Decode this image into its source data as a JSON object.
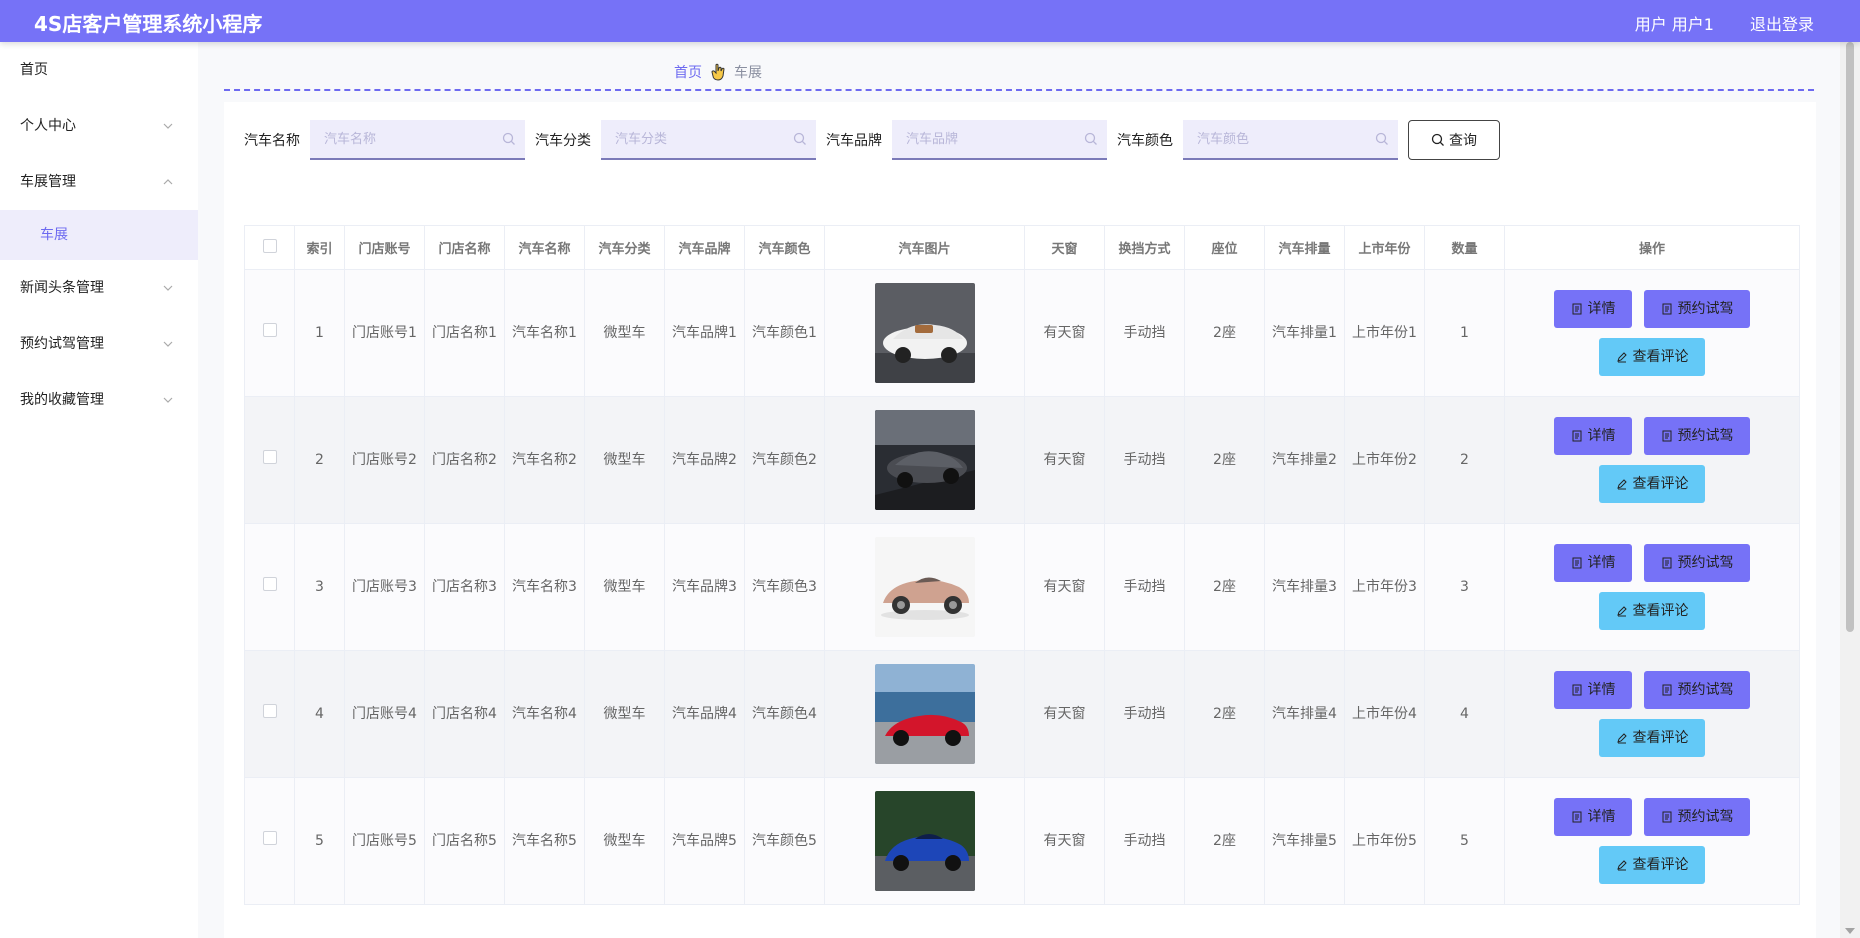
{
  "header": {
    "title": "4S店客户管理系统小程序",
    "user": "用户 用户1",
    "logout": "退出登录"
  },
  "sidebar": {
    "items": [
      {
        "label": "首页",
        "chevron": "none"
      },
      {
        "label": "个人中心",
        "chevron": "down"
      },
      {
        "label": "车展管理",
        "chevron": "up"
      },
      {
        "label": "车展",
        "chevron": "sub"
      },
      {
        "label": "新闻头条管理",
        "chevron": "down"
      },
      {
        "label": "预约试驾管理",
        "chevron": "down"
      },
      {
        "label": "我的收藏管理",
        "chevron": "down"
      }
    ]
  },
  "breadcrumb": {
    "home": "首页",
    "separator_icon": "hand-pointer-icon",
    "current": "车展"
  },
  "search": {
    "fields": [
      {
        "label": "汽车名称",
        "placeholder": "汽车名称"
      },
      {
        "label": "汽车分类",
        "placeholder": "汽车分类"
      },
      {
        "label": "汽车品牌",
        "placeholder": "汽车品牌"
      },
      {
        "label": "汽车颜色",
        "placeholder": "汽车颜色"
      }
    ],
    "button": "查询"
  },
  "table": {
    "headers": [
      "",
      "索引",
      "门店账号",
      "门店名称",
      "汽车名称",
      "汽车分类",
      "汽车品牌",
      "汽车颜色",
      "汽车图片",
      "天窗",
      "换挡方式",
      "座位",
      "汽车排量",
      "上市年份",
      "数量",
      "操作"
    ],
    "rows": [
      {
        "index": "1",
        "store_account": "门店账号1",
        "store_name": "门店名称1",
        "car_name": "汽车名称1",
        "category": "微型车",
        "brand": "汽车品牌1",
        "color": "汽车颜色1",
        "image": "white-roadster",
        "sunroof": "有天窗",
        "transmission": "手动挡",
        "seats": "2座",
        "displacement": "汽车排量1",
        "year": "上市年份1",
        "quantity": "1"
      },
      {
        "index": "2",
        "store_account": "门店账号2",
        "store_name": "门店名称2",
        "car_name": "汽车名称2",
        "category": "微型车",
        "brand": "汽车品牌2",
        "color": "汽车颜色2",
        "image": "grey-roadster",
        "sunroof": "有天窗",
        "transmission": "手动挡",
        "seats": "2座",
        "displacement": "汽车排量2",
        "year": "上市年份2",
        "quantity": "2"
      },
      {
        "index": "3",
        "store_account": "门店账号3",
        "store_name": "门店名称3",
        "car_name": "汽车名称3",
        "category": "微型车",
        "brand": "汽车品牌3",
        "color": "汽车颜色3",
        "image": "copper-coupe",
        "sunroof": "有天窗",
        "transmission": "手动挡",
        "seats": "2座",
        "displacement": "汽车排量3",
        "year": "上市年份3",
        "quantity": "3"
      },
      {
        "index": "4",
        "store_account": "门店账号4",
        "store_name": "门店名称4",
        "car_name": "汽车名称4",
        "category": "微型车",
        "brand": "汽车品牌4",
        "color": "汽车颜色4",
        "image": "red-convertible",
        "sunroof": "有天窗",
        "transmission": "手动挡",
        "seats": "2座",
        "displacement": "汽车排量4",
        "year": "上市年份4",
        "quantity": "4"
      },
      {
        "index": "5",
        "store_account": "门店账号5",
        "store_name": "门店名称5",
        "car_name": "汽车名称5",
        "category": "微型车",
        "brand": "汽车品牌5",
        "color": "汽车颜色5",
        "image": "blue-coupe",
        "sunroof": "有天窗",
        "transmission": "手动挡",
        "seats": "2座",
        "displacement": "汽车排量5",
        "year": "上市年份5",
        "quantity": "5"
      }
    ],
    "actions": {
      "detail": "详情",
      "book": "预约试驾",
      "comment": "查看评论"
    }
  },
  "colors": {
    "primary": "#7672f7",
    "accent_blue": "#63c9f7",
    "active_menu_bg": "#eeedfb"
  }
}
